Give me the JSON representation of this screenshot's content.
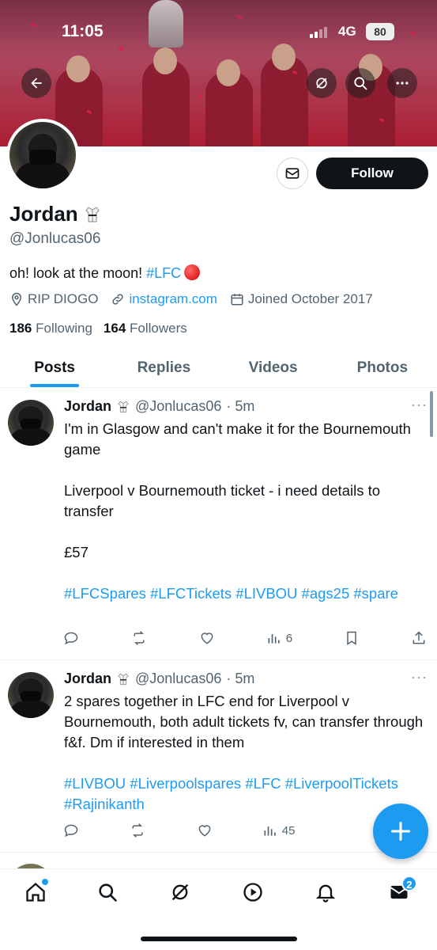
{
  "status_bar": {
    "time": "11:05",
    "network": "4G",
    "battery": "80"
  },
  "profile": {
    "name": "Jordan",
    "handle": "@Jonlucas06",
    "bio_text": "oh! look at the moon! ",
    "bio_tag": "#LFC",
    "location": "RIP DIOGO",
    "website": "instagram.com",
    "joined": "Joined October 2017",
    "following_count": "186",
    "following_label": "Following",
    "followers_count": "164",
    "followers_label": "Followers",
    "follow_label": "Follow"
  },
  "tabs": [
    {
      "label": "Posts",
      "active": true
    },
    {
      "label": "Replies",
      "active": false
    },
    {
      "label": "Videos",
      "active": false
    },
    {
      "label": "Photos",
      "active": false
    }
  ],
  "posts": [
    {
      "name": "Jordan",
      "handle": "@Jonlucas06",
      "time": "· 5m",
      "paragraphs": [
        "I'm in Glasgow and can't make it for the Bournemouth game",
        "Liverpool v Bournemouth ticket - i need details to transfer",
        "£57"
      ],
      "tags": "#LFCSpares #LFCTickets #LIVBOU #ags25 #spare",
      "views": "6"
    },
    {
      "name": "Jordan",
      "handle": "@Jonlucas06",
      "time": "· 5m",
      "paragraphs": [
        "2 spares together in LFC end for Liverpool v Bournemouth, both adult tickets fv, can transfer through f&f. Dm if interested in them"
      ],
      "tags": "#LIVBOU #Liverpoolspares #LFC #LiverpoolTickets #Rajinikanth",
      "views": "45"
    }
  ],
  "nav": {
    "messages_badge": "2"
  },
  "colors": {
    "accent": "#1d9bf0",
    "text": "#0f1419",
    "muted": "#536471",
    "follow_bg": "#0f1419"
  }
}
